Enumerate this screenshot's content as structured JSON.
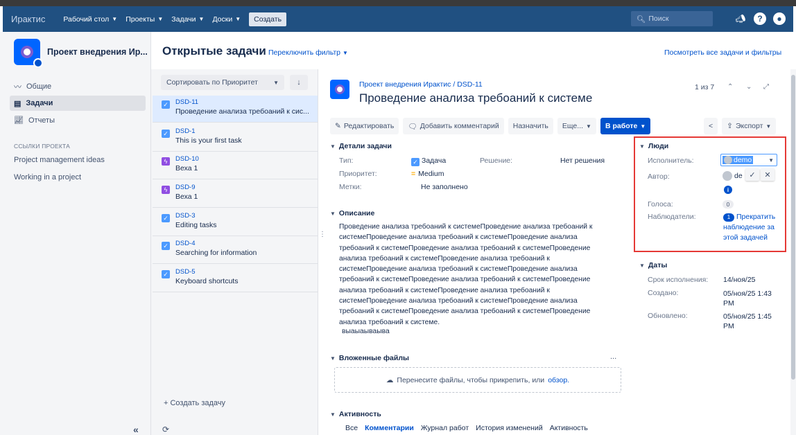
{
  "topbar": {
    "logo": "Иpактис",
    "nav": [
      {
        "label": "Рабочий стол"
      },
      {
        "label": "Проекты"
      },
      {
        "label": "Задачи"
      },
      {
        "label": "Доски"
      }
    ],
    "create_label": "Создать",
    "search_placeholder": "Поиск"
  },
  "sidebar": {
    "project_name": "Проект внедрения Ир...",
    "items": [
      {
        "label": "Общие"
      },
      {
        "label": "Задачи"
      },
      {
        "label": "Отчеты"
      }
    ],
    "links_heading": "ССЫЛКИ ПРОЕКТА",
    "links": [
      {
        "label": "Project management ideas"
      },
      {
        "label": "Working in a project"
      }
    ],
    "collapse": "«"
  },
  "header": {
    "title": "Открытые задачи",
    "switch_filter": "Переключить фильтр",
    "view_all": "Посмотреть все задачи и фильтры"
  },
  "list": {
    "sort_label": "Сортировать по Приоритет",
    "issues": [
      {
        "key": "DSD-11",
        "summary": "Проведение анализа требоаний к сис..."
      },
      {
        "key": "DSD-1",
        "summary": "This is your first task"
      },
      {
        "key": "DSD-10",
        "summary": "Веха 1"
      },
      {
        "key": "DSD-9",
        "summary": "Веха 1"
      },
      {
        "key": "DSD-3",
        "summary": "Editing tasks"
      },
      {
        "key": "DSD-4",
        "summary": "Searching for information"
      },
      {
        "key": "DSD-5",
        "summary": "Keyboard shortcuts"
      }
    ],
    "create_task": "+ Создать задачу"
  },
  "detail": {
    "breadcrumb_project": "Проект внедрения Иpактис",
    "breadcrumb_key": "DSD-11",
    "title": "Проведение анализа требоаний к системе",
    "pager": "1 из 7",
    "toolbar": {
      "edit": "Редактировать",
      "comment": "Добавить комментарий",
      "assign": "Назначить",
      "more": "Еще...",
      "status": "В работе",
      "export": "Экспорт"
    },
    "details_heading": "Детали задачи",
    "type_label": "Тип:",
    "type_value": "Задача",
    "resolution_label": "Решение:",
    "resolution_value": "Нет решения",
    "priority_label": "Приоритет:",
    "priority_value": "Medium",
    "labels_label": "Метки:",
    "labels_value": "Не заполнено",
    "description_heading": "Описание",
    "description": "Проведение анализа требоаний к системеПроведение анализа требоаний к системеПроведение анализа требоаний к системеПроведение анализа требоаний к системеПроведение анализа требоаний к системеПроведение анализа требоаний к системеПроведение анализа требоаний к системеПроведение анализа требоаний к системеПроведение анализа требоаний к системеПроведение анализа требоаний к системеПроведение анализа требоаний к системеПроведение анализа требоаний к системеПроведение анализа требоаний к системеПроведение анализа требоаний к системеПроведение анализа требоаний к системеПроведение анализа требоаний к системе.",
    "description_extra": "выаыаываыва",
    "attachments_heading": "Вложенные файлы",
    "attachments_more": "...",
    "drop_text": "Перенесите файлы, чтобы прикрепить, или",
    "drop_link": "обзор.",
    "activity_heading": "Активность",
    "activity_tabs": {
      "all": "Все",
      "comments": "Комментарии",
      "worklog": "Журнал работ",
      "history": "История изменений",
      "activity": "Активность"
    }
  },
  "people": {
    "heading": "Люди",
    "assignee_label": "Исполнитель:",
    "assignee_value": "demo",
    "reporter_label": "Автор:",
    "reporter_value": "de",
    "votes_label": "Голоса:",
    "votes_value": "0",
    "watchers_label": "Наблюдатели:",
    "watchers_count": "1",
    "watchers_action": "Прекратить наблюдение за этой задачей"
  },
  "dates": {
    "heading": "Даты",
    "due_label": "Срок исполнения:",
    "due_value": "14/ноя/25",
    "created_label": "Создано:",
    "created_value": "05/ноя/25 1:43 PM",
    "updated_label": "Обновлено:",
    "updated_value": "05/ноя/25 1:45 PM"
  },
  "colors": {
    "topbar": "#205081",
    "accent": "#0052cc",
    "highlight": "#e53935"
  }
}
